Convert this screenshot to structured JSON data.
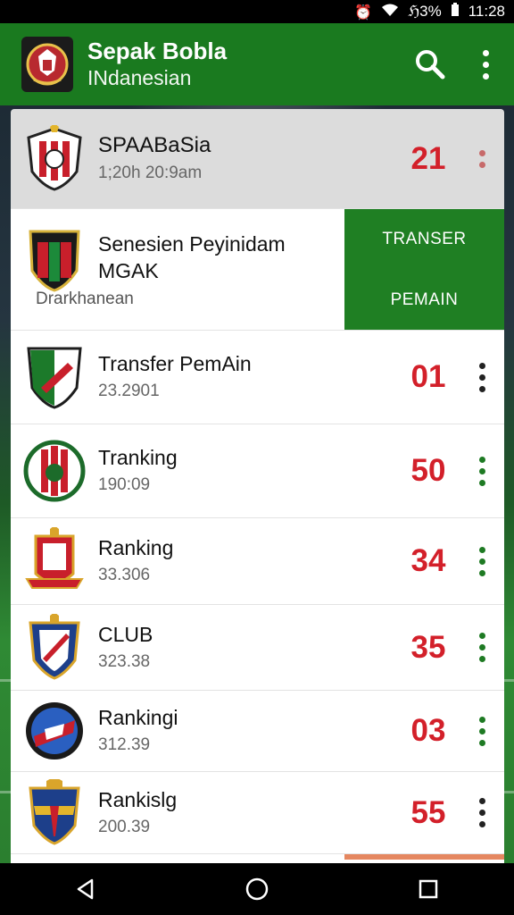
{
  "status_bar": {
    "battery": "ℌ3%",
    "time": "11:28"
  },
  "app": {
    "title": "Sepak Bobla",
    "subtitle": "INdanesian"
  },
  "rows": [
    {
      "name": "SPAABaSia",
      "meta": "1;20h  20:9am",
      "score": "21"
    },
    {
      "name_line1": "Senesien Peyinidam",
      "name_line2": "MGAK",
      "sub": "Drarkhanean",
      "action_top": "TRANSER",
      "action_bottom": "PEMAIN"
    },
    {
      "name": "Transfer PemAin",
      "meta": "23.2901",
      "score": "01"
    },
    {
      "name": "Tranking",
      "meta": "190:09",
      "score": "50"
    },
    {
      "name": "Ranking",
      "meta": "33.306",
      "score": "34"
    },
    {
      "name": "CLUB",
      "meta": "323.38",
      "score": "35"
    },
    {
      "name": "Rankingi",
      "meta": "312.39",
      "score": "03"
    },
    {
      "name": "Rankislg",
      "meta": "200.39",
      "score": "55"
    }
  ],
  "colors": {
    "appbar": "#1a7a1f",
    "score": "#d3202a",
    "menu_dots_dark": "#222222",
    "menu_dots_green": "#1e7a23"
  },
  "icons": [
    "wifi-icon",
    "battery-icon",
    "search-icon",
    "more-vert-icon",
    "back-icon",
    "home-icon",
    "recents-icon"
  ]
}
